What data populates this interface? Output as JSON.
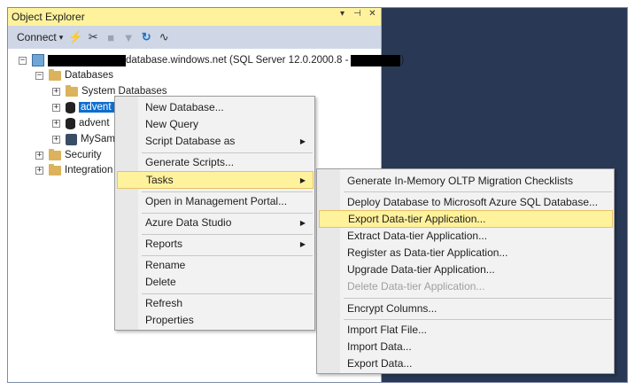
{
  "window": {
    "title": "Object Explorer",
    "actions": [
      "▾",
      "📌",
      "✕"
    ]
  },
  "toolbar": {
    "connect_label": "Connect",
    "connect_caret": "▾"
  },
  "tree": {
    "server_label": "database.windows.net (SQL Server 12.0.2000.8 -",
    "server_close": ")",
    "databases_label": "Databases",
    "system_databases_label": "System Databases",
    "db1_label": "advent",
    "db2_label": "advent",
    "db3_label": "MySam",
    "security_label": "Security",
    "integration_label": "Integration",
    "expand_glyph": "+",
    "collapse_glyph": "−"
  },
  "context_menu": {
    "items": [
      "New Database...",
      "New Query",
      "Script Database as",
      "Generate Scripts...",
      "Tasks",
      "Open in Management Portal...",
      "Azure Data Studio",
      "Reports",
      "Rename",
      "Delete",
      "Refresh",
      "Properties"
    ],
    "submenu_arrow": "▶"
  },
  "tasks_submenu": {
    "items": [
      "Generate In-Memory OLTP Migration Checklists",
      "Deploy Database to Microsoft Azure SQL Database...",
      "Export Data-tier Application...",
      "Extract Data-tier Application...",
      "Register as Data-tier Application...",
      "Upgrade Data-tier Application...",
      "Delete Data-tier Application...",
      "Encrypt Columns...",
      "Import Flat File...",
      "Import Data...",
      "Export Data..."
    ],
    "highlighted": "Export Data-tier Application...",
    "disabled": "Delete Data-tier Application..."
  },
  "colors": {
    "title_bar": "#fff29d",
    "toolbar": "#cfd6e5",
    "selection": "#0e6ecf",
    "right_pane": "#293955",
    "menu_highlight": "#fff29d"
  }
}
